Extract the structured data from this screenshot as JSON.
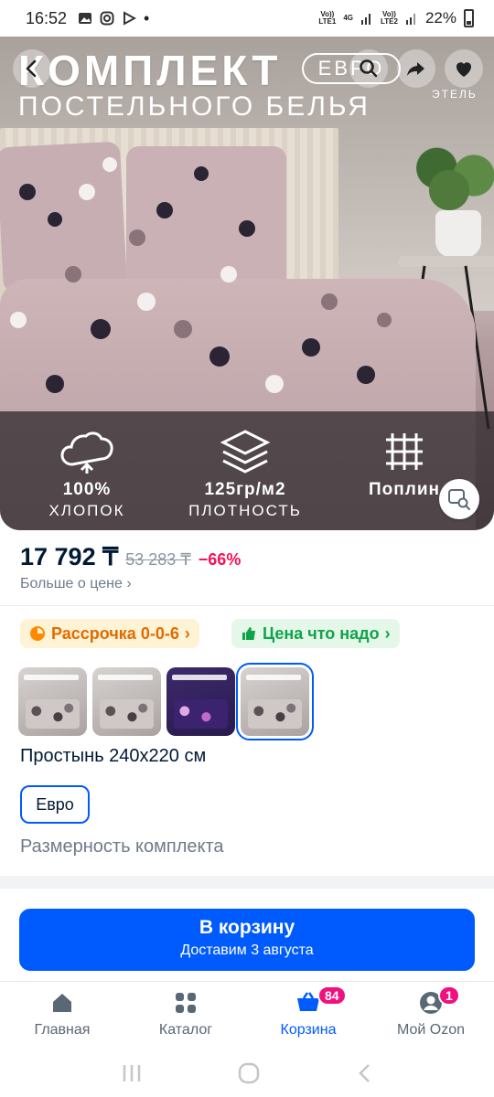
{
  "status_bar": {
    "time": "16:52",
    "net1": "Vo)) LTE1",
    "net_4g": "4G",
    "net2": "Vo)) LTE2",
    "battery": "22%"
  },
  "hero": {
    "title_line1": "КОМПЛЕКТ",
    "title_line2": "ПОСТЕЛЬНОГО БЕЛЬЯ",
    "badge": "ЕВРО",
    "brand": "ЭТЕЛЬ",
    "features": [
      {
        "value": "100%",
        "label": "ХЛОПОК",
        "icon": "cotton-icon"
      },
      {
        "value": "125гр/м2",
        "label": "ПЛОТНОСТЬ",
        "icon": "layers-icon"
      },
      {
        "value": "Поплин",
        "label": "",
        "icon": "weave-icon"
      }
    ]
  },
  "price": {
    "current": "17 792 ₸",
    "old": "53 283 ₸",
    "discount": "−66%",
    "more": "Больше о цене"
  },
  "chips": {
    "installment": "Рассрочка 0-0-6",
    "fair_price": "Цена что надо"
  },
  "variant": {
    "sheet_size": "Простынь 240x220 см",
    "selected_size": "Евро",
    "size_label": "Размерность комплекта"
  },
  "cart_button": {
    "label": "В корзину",
    "sublabel": "Доставим 3 августа"
  },
  "tabs": [
    {
      "label": "Главная",
      "icon": "home-icon"
    },
    {
      "label": "Каталог",
      "icon": "catalog-icon"
    },
    {
      "label": "Корзина",
      "icon": "cart-icon",
      "badge": "84"
    },
    {
      "label": "Мой Ozon",
      "icon": "profile-icon",
      "badge": "1"
    }
  ],
  "colors": {
    "accent": "#005bff",
    "discount": "#f91155",
    "badge": "#f1117e"
  }
}
